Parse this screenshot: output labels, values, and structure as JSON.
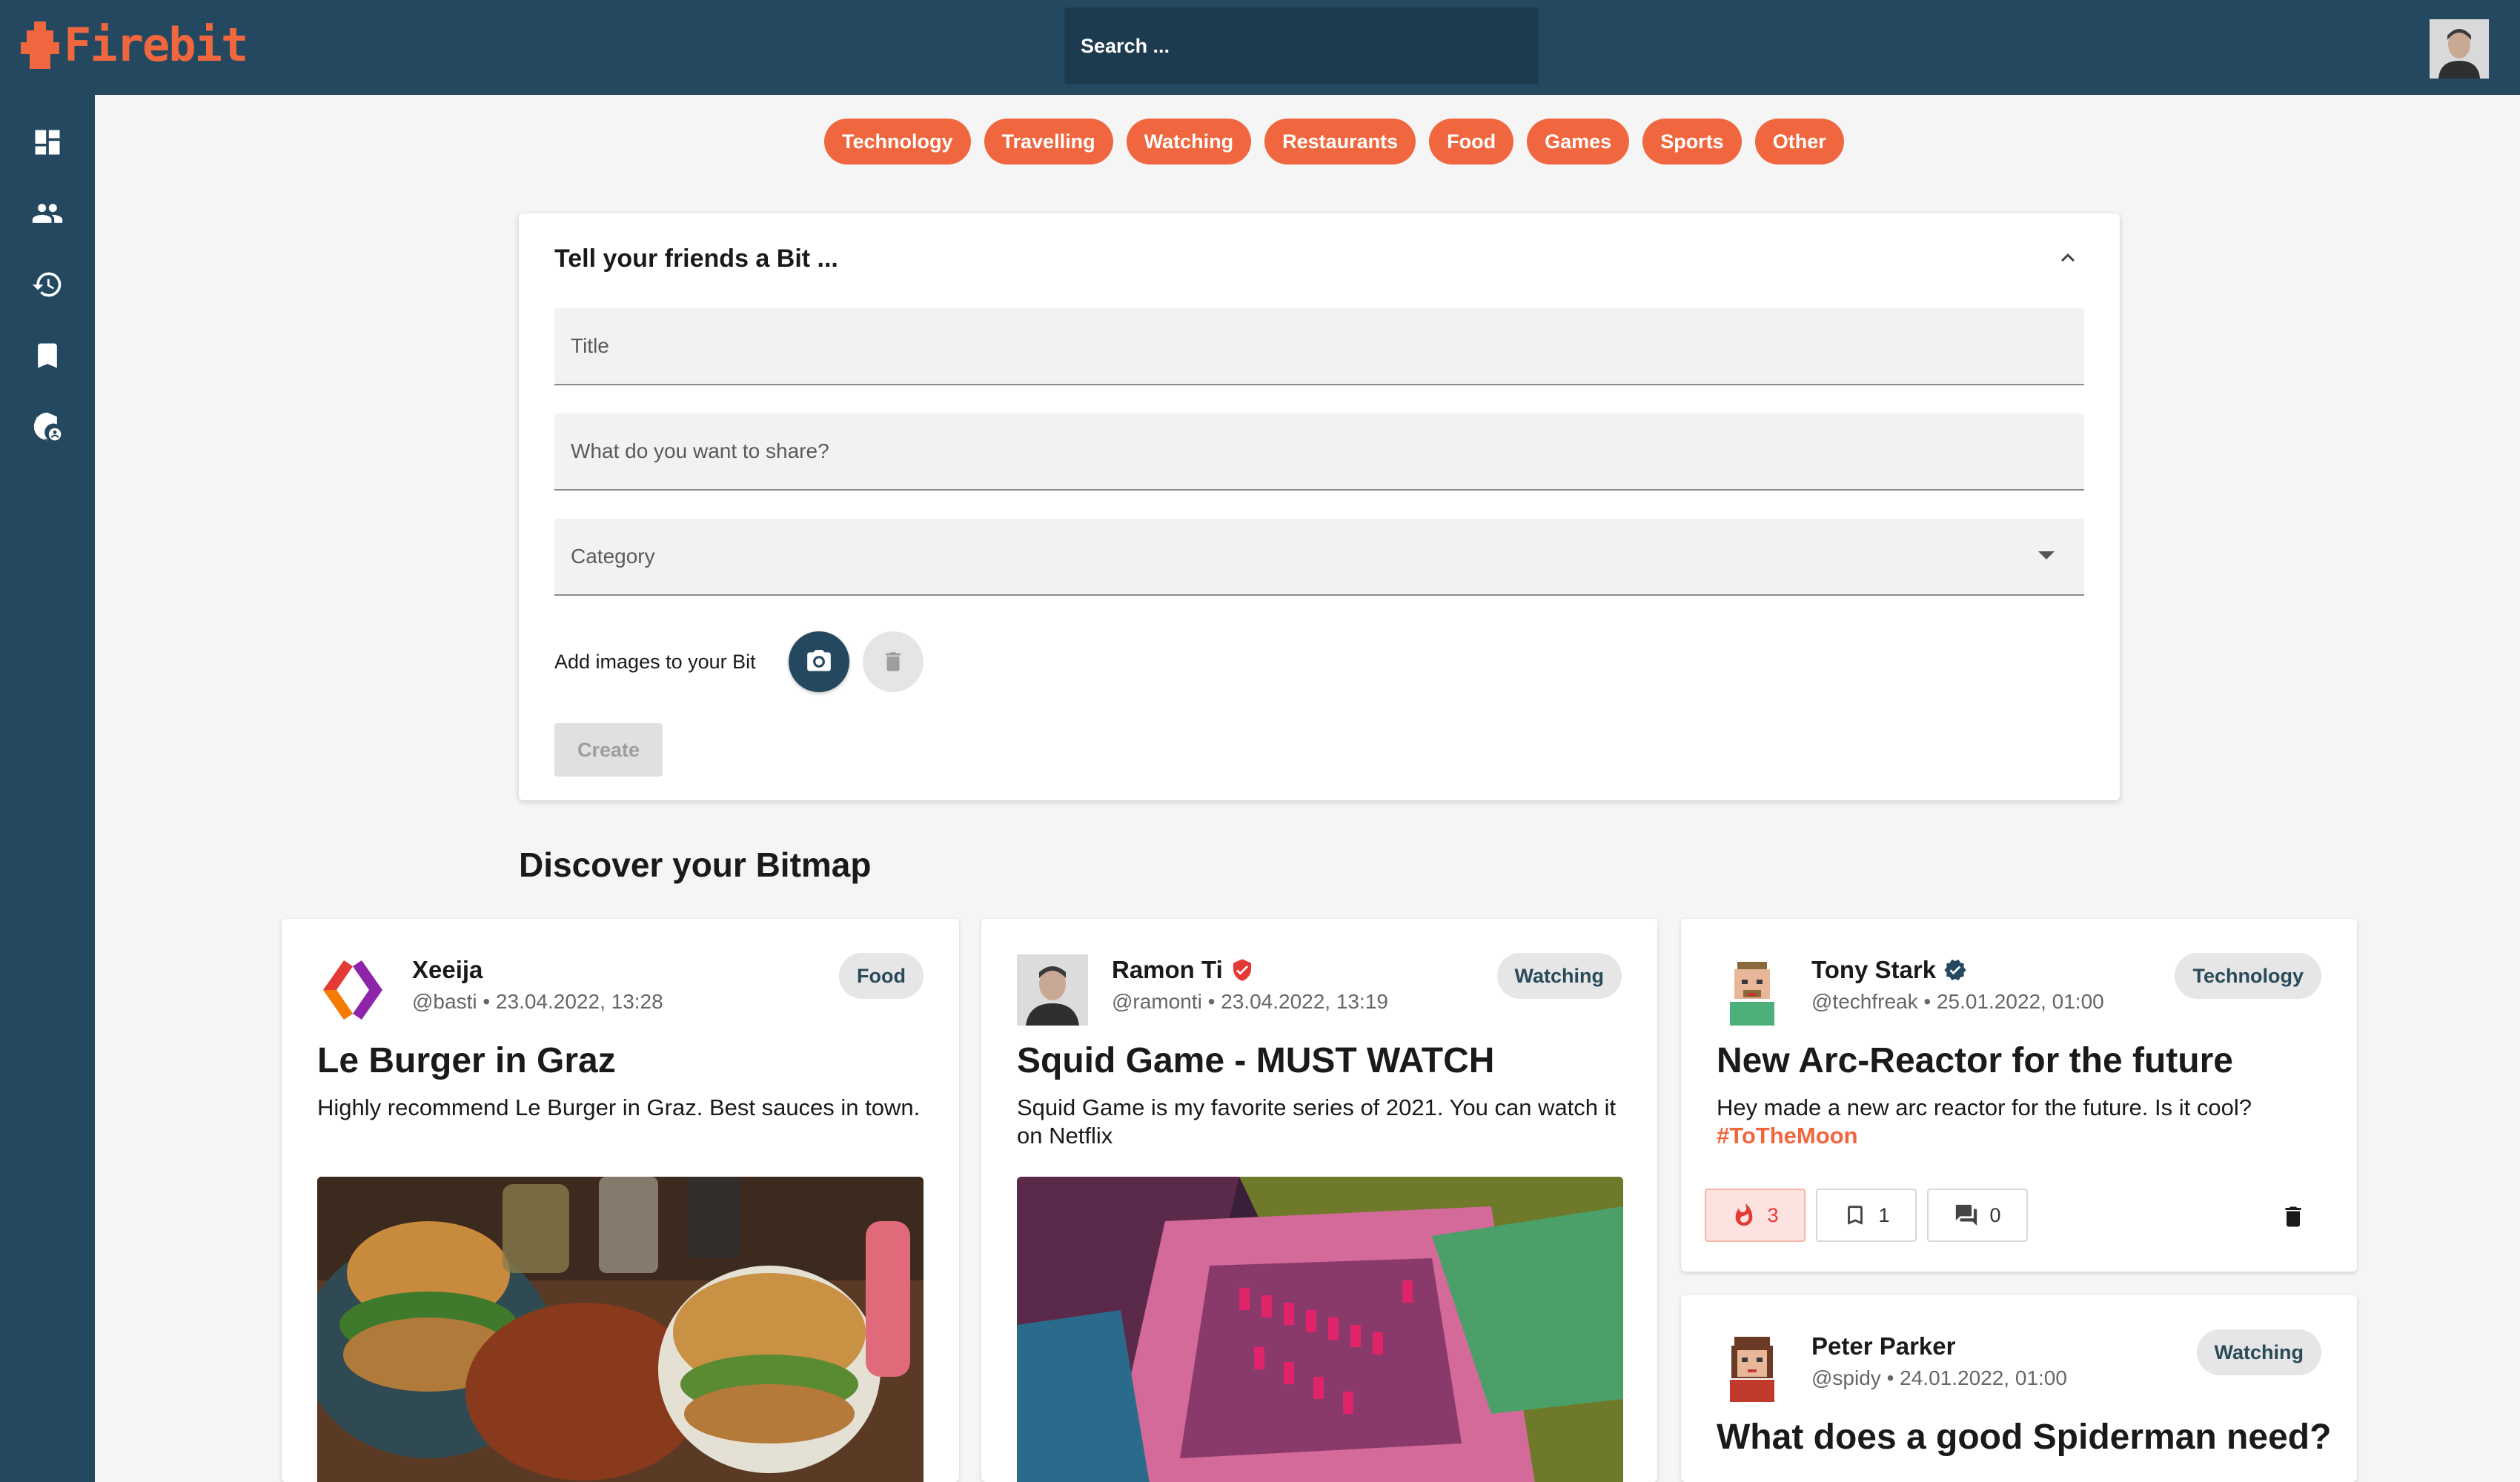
{
  "app": {
    "name": "Firebit"
  },
  "search": {
    "placeholder": "Search ..."
  },
  "sidebar": {
    "items": [
      {
        "icon": "dashboard-icon"
      },
      {
        "icon": "people-icon"
      },
      {
        "icon": "history-icon"
      },
      {
        "icon": "bookmark-icon"
      },
      {
        "icon": "admin-shield-icon"
      }
    ]
  },
  "categories": [
    "Technology",
    "Travelling",
    "Watching",
    "Restaurants",
    "Food",
    "Games",
    "Sports",
    "Other"
  ],
  "create": {
    "heading": "Tell your friends a Bit ...",
    "title_placeholder": "Title",
    "content_placeholder": "What do you want to share?",
    "category_placeholder": "Category",
    "images_label": "Add images to your Bit",
    "create_label": "Create"
  },
  "feed": {
    "title": "Discover your Bitmap",
    "posts": [
      {
        "name": "Xeeija",
        "meta": "@basti • 23.04.2022, 13:28",
        "category": "Food",
        "title": "Le Burger in Graz",
        "body": "Highly recommend Le Burger in Graz. Best sauces in town."
      },
      {
        "name": "Ramon Ti",
        "meta": "@ramonti • 23.04.2022, 13:19",
        "category": "Watching",
        "title": "Squid Game - MUST WATCH",
        "body": "Squid Game is my favorite series of 2021. You can watch it on Netflix"
      },
      {
        "name": "Tony Stark",
        "meta": "@techfreak • 25.01.2022, 01:00",
        "category": "Technology",
        "title": "New Arc-Reactor for the future",
        "body": "Hey made a new arc reactor for the future. Is it cool?",
        "hashtag": "#ToTheMoon",
        "fire_count": "3",
        "bookmark_count": "1",
        "comment_count": "0"
      },
      {
        "name": "Peter Parker",
        "meta": "@spidy • 24.01.2022, 01:00",
        "category": "Watching",
        "title": "What does a good Spiderman need?"
      }
    ]
  },
  "colors": {
    "primary": "#24485f",
    "accent": "#f0673f"
  }
}
